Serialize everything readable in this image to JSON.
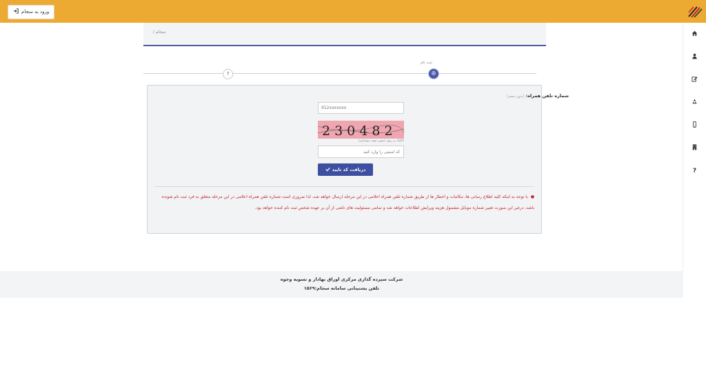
{
  "header": {
    "login_label": "ورود به سجام",
    "login_icon": "sign-in-icon",
    "accent_color": "#ecaa33",
    "logo_icon": "sejam-logo-icon"
  },
  "sidebar": {
    "items": [
      {
        "icon": "home-icon"
      },
      {
        "icon": "user-icon"
      },
      {
        "icon": "edit-icon"
      },
      {
        "icon": "recycle-icon"
      },
      {
        "icon": "mobile-icon"
      },
      {
        "icon": "building-icon"
      },
      {
        "icon": "question-icon",
        "label": "?"
      }
    ]
  },
  "breadcrumb": {
    "item": "سجام",
    "separator": "/"
  },
  "stepper": {
    "active_label": "ثبت نام",
    "active_symbol": "®",
    "next_symbol": "?",
    "active_color": "#4a5aa8"
  },
  "form": {
    "phone_label": "شماره تلفن همراه:",
    "phone_hint": "(بدون صفر)",
    "phone_placeholder": "912xxxxxxx",
    "captcha_text": "230482",
    "captcha_hint": "(کلیک بر روی تصویر جهت نوسازی)",
    "code_placeholder": "کد امنیتی را وارد کنید",
    "submit_label": "دریافت کد تایید",
    "submit_color": "#3c4fa0"
  },
  "notice": {
    "text": "با توجه به اینکه کلیه اطلاع رسانی ها، مکاتبات و اخطار ها از طریق شماره تلفن همراه اعلامی در این مرحله ارسال خواهد شد، لذا ضروری است شماره تلفن همراه اعلامی در این مرحله متعلق به فرد ثبت نام شونده باشد، درغیر این صورت تغییر شماره موبایل مشمول هزینه ویرایش اطلاعات خواهد شد و تمامی مسئولیت های ناشی از آن بر عهده شخص ثبت نام کننده خواهد بود.",
    "color": "#c2202f"
  },
  "footer": {
    "company": "شرکت سپرده گذاری مرکزی اوراق بهادار و تسویه وجوه",
    "support": "تلفن پشتیبانی سامانه سجام:۱۵۶۹"
  }
}
